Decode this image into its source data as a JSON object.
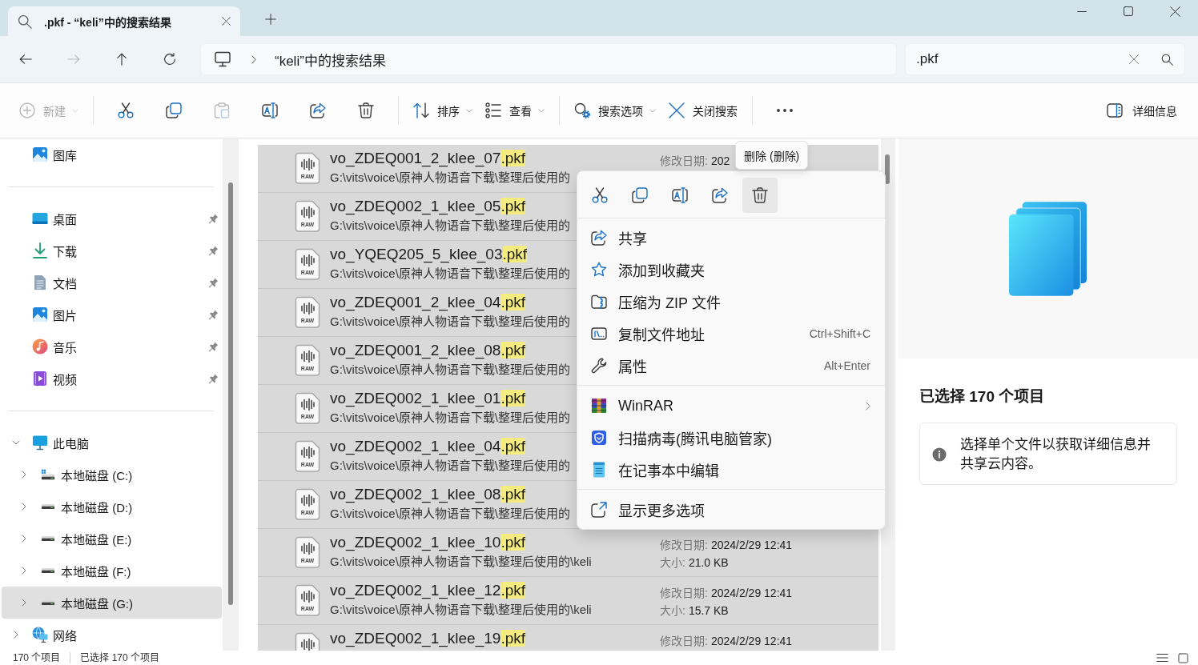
{
  "window": {
    "tabs": [
      {
        "title": ".pkf - “keli”中的搜索结果",
        "selected": true
      }
    ]
  },
  "navigation": {
    "buttons": [
      {
        "disabled": false
      },
      {
        "disabled": true
      },
      {
        "disabled": false
      },
      {
        "disabled": false
      }
    ],
    "address": "“keli”中的搜索结果",
    "search": {
      "value": ".pkf"
    }
  },
  "toolbar": {
    "items": [
      {
        "kind": "menu",
        "label": "新建",
        "disabled": true
      },
      {
        "kind": "separator"
      },
      {
        "kind": "icon",
        "disabled": false
      },
      {
        "kind": "icon",
        "disabled": false
      },
      {
        "kind": "icon",
        "disabled": true
      },
      {
        "kind": "icon",
        "disabled": false
      },
      {
        "kind": "icon",
        "disabled": false
      },
      {
        "kind": "icon",
        "disabled": false
      },
      {
        "kind": "separator"
      },
      {
        "kind": "menu",
        "label": "排序",
        "disabled": false
      },
      {
        "kind": "menu",
        "label": "查看",
        "disabled": false
      },
      {
        "kind": "separator"
      },
      {
        "kind": "menu",
        "label": "搜索选项",
        "disabled": false
      },
      {
        "kind": "button",
        "label": "关闭搜索",
        "disabled": false
      },
      {
        "kind": "separator"
      },
      {
        "kind": "icon",
        "disabled": false
      }
    ],
    "details_button": {
      "label": "详细信息"
    }
  },
  "sidebar": {
    "sections": [
      {
        "items": [
          {
            "label": "图库",
            "selected": false
          }
        ]
      },
      {
        "items": [
          {
            "label": "桌面",
            "pinned": true,
            "selected": false
          },
          {
            "label": "下载",
            "pinned": true,
            "selected": false
          },
          {
            "label": "文档",
            "pinned": true,
            "selected": false
          },
          {
            "label": "图片",
            "pinned": true,
            "selected": false
          },
          {
            "label": "音乐",
            "pinned": true,
            "selected": false
          },
          {
            "label": "视频",
            "pinned": true,
            "selected": false
          }
        ]
      },
      {
        "items": [
          {
            "label": "此电脑",
            "expanded": true,
            "selected": false,
            "children": [
              {
                "label": "本地磁盘 (C:)",
                "expanded": false,
                "selected": false
              },
              {
                "label": "本地磁盘 (D:)",
                "expanded": false,
                "selected": false
              },
              {
                "label": "本地磁盘 (E:)",
                "expanded": false,
                "selected": false
              },
              {
                "label": "本地磁盘 (F:)",
                "expanded": false,
                "selected": false
              },
              {
                "label": "本地磁盘 (G:)",
                "expanded": false,
                "selected": true
              }
            ]
          },
          {
            "label": "网络",
            "expanded": false,
            "selected": false
          }
        ]
      }
    ]
  },
  "files": {
    "rows": [
      {
        "name": "vo_ZDEQ001_2_klee_07",
        "match": ".pkf",
        "type_label": "RAW",
        "path": "G:\\vits\\voice\\原神人物语音下载\\整理后使用的",
        "date_label": "修改日期:",
        "date": "202",
        "selected": true
      },
      {
        "name": "vo_ZDEQ002_1_klee_05",
        "match": ".pkf",
        "type_label": "RAW",
        "path": "G:\\vits\\voice\\原神人物语音下载\\整理后使用的",
        "selected": true
      },
      {
        "name": "vo_YQEQ205_5_klee_03",
        "match": ".pkf",
        "type_label": "RAW",
        "path": "G:\\vits\\voice\\原神人物语音下载\\整理后使用的",
        "selected": true
      },
      {
        "name": "vo_ZDEQ001_2_klee_04",
        "match": ".pkf",
        "type_label": "RAW",
        "path": "G:\\vits\\voice\\原神人物语音下载\\整理后使用的",
        "selected": true
      },
      {
        "name": "vo_ZDEQ001_2_klee_08",
        "match": ".pkf",
        "type_label": "RAW",
        "path": "G:\\vits\\voice\\原神人物语音下载\\整理后使用的",
        "selected": true
      },
      {
        "name": "vo_ZDEQ002_1_klee_01",
        "match": ".pkf",
        "type_label": "RAW",
        "path": "G:\\vits\\voice\\原神人物语音下载\\整理后使用的",
        "selected": true
      },
      {
        "name": "vo_ZDEQ002_1_klee_04",
        "match": ".pkf",
        "type_label": "RAW",
        "path": "G:\\vits\\voice\\原神人物语音下载\\整理后使用的",
        "selected": true
      },
      {
        "name": "vo_ZDEQ002_1_klee_08",
        "match": ".pkf",
        "type_label": "RAW",
        "path": "G:\\vits\\voice\\原神人物语音下载\\整理后使用的",
        "selected": true
      },
      {
        "name": "vo_ZDEQ002_1_klee_10",
        "match": ".pkf",
        "type_label": "RAW",
        "path": "G:\\vits\\voice\\原神人物语音下载\\整理后使用的\\keli",
        "date_label": "修改日期:",
        "date": "2024/2/29 12:41",
        "size_label": "大小:",
        "size": "21.0 KB",
        "selected": true
      },
      {
        "name": "vo_ZDEQ002_1_klee_12",
        "match": ".pkf",
        "type_label": "RAW",
        "path": "G:\\vits\\voice\\原神人物语音下载\\整理后使用的\\keli",
        "date_label": "修改日期:",
        "date": "2024/2/29 12:41",
        "size_label": "大小:",
        "size": "15.7 KB",
        "selected": true
      },
      {
        "name": "vo_ZDEQ002_1_klee_19",
        "match": ".pkf",
        "date_label": "修改日期:",
        "date": "2024/2/29 12:41",
        "selected": true
      }
    ]
  },
  "context_menu": {
    "quick_actions": [
      {
        "hovered": false
      },
      {
        "hovered": false
      },
      {
        "hovered": false
      },
      {
        "hovered": false
      },
      {
        "hovered": true
      }
    ],
    "tooltip": "删除 (删除)",
    "groups": [
      {
        "items": [
          {
            "label": "共享",
            "submenu": false
          },
          {
            "label": "添加到收藏夹",
            "submenu": false
          },
          {
            "label": "压缩为 ZIP 文件",
            "submenu": false
          },
          {
            "label": "复制文件地址",
            "shortcut": "Ctrl+Shift+C",
            "submenu": false
          },
          {
            "label": "属性",
            "shortcut": "Alt+Enter",
            "submenu": false
          }
        ]
      },
      {
        "items": [
          {
            "label": "WinRAR",
            "submenu": true
          },
          {
            "label": "扫描病毒(腾讯电脑管家)",
            "submenu": false
          },
          {
            "label": "在记事本中编辑",
            "submenu": false
          }
        ]
      },
      {
        "items": [
          {
            "label": "显示更多选项",
            "submenu": false
          }
        ]
      }
    ]
  },
  "details_pane": {
    "title": "已选择 170 个项目",
    "info": "选择单个文件以获取详细信息并共享云内容。"
  },
  "status_bar": {
    "item_count": "170 个项目",
    "selection": "已选择 170 个项目"
  }
}
